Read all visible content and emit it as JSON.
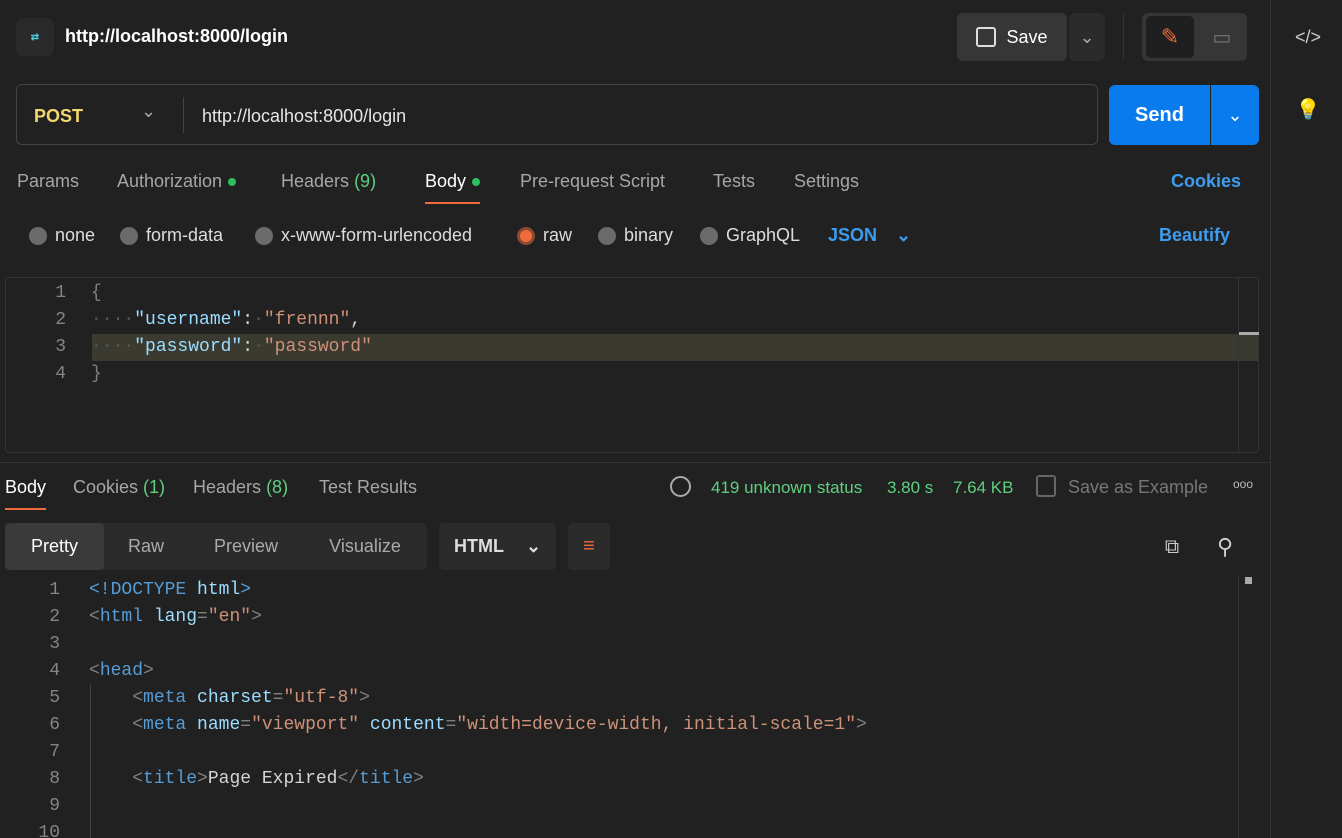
{
  "header": {
    "title": "http://localhost:8000/login",
    "save_label": "Save"
  },
  "request": {
    "method": "POST",
    "url": "http://localhost:8000/login",
    "send_label": "Send"
  },
  "req_tabs": [
    {
      "label": "Params"
    },
    {
      "label": "Authorization",
      "dot": true
    },
    {
      "label": "Headers",
      "count": "(9)"
    },
    {
      "label": "Body",
      "dot": true,
      "active": true
    },
    {
      "label": "Pre-request Script"
    },
    {
      "label": "Tests"
    },
    {
      "label": "Settings"
    }
  ],
  "cookies_link": "Cookies",
  "body_types": [
    {
      "label": "none"
    },
    {
      "label": "form-data"
    },
    {
      "label": "x-www-form-urlencoded"
    },
    {
      "label": "raw",
      "selected": true
    },
    {
      "label": "binary"
    },
    {
      "label": "GraphQL"
    }
  ],
  "body_format": "JSON",
  "beautify_label": "Beautify",
  "request_body": [
    [
      [
        "t-pun",
        "{"
      ]
    ],
    [
      [
        "t-ws",
        "····"
      ],
      [
        "t-key",
        "\"username\""
      ],
      [
        "t-txt",
        ":"
      ],
      [
        "t-ws",
        "·"
      ],
      [
        "t-str",
        "\"frennn\""
      ],
      [
        "t-txt",
        ","
      ]
    ],
    [
      [
        "t-ws",
        "····"
      ],
      [
        "t-key",
        "\"password\""
      ],
      [
        "t-txt",
        ":"
      ],
      [
        "t-ws",
        "·"
      ],
      [
        "t-str",
        "\"password\""
      ]
    ],
    [
      [
        "t-pun",
        "}"
      ]
    ]
  ],
  "resp_tabs": [
    {
      "label": "Body",
      "active": true
    },
    {
      "label": "Cookies",
      "count": "(1)"
    },
    {
      "label": "Headers",
      "count": "(8)"
    },
    {
      "label": "Test Results"
    }
  ],
  "response": {
    "status": "419 unknown status",
    "time": "3.80 s",
    "size": "7.64 KB",
    "save_example": "Save as Example"
  },
  "view_modes": [
    {
      "label": "Pretty",
      "active": true
    },
    {
      "label": "Raw"
    },
    {
      "label": "Preview"
    },
    {
      "label": "Visualize"
    }
  ],
  "resp_format": "HTML",
  "response_body": [
    [
      [
        "t-tag",
        "<!DOCTYPE "
      ],
      [
        "t-attr",
        "html"
      ],
      [
        "t-tag",
        ">"
      ]
    ],
    [
      [
        "t-pun",
        "<"
      ],
      [
        "t-tag",
        "html "
      ],
      [
        "t-attr",
        "lang"
      ],
      [
        "t-pun",
        "="
      ],
      [
        "t-str",
        "\"en\""
      ],
      [
        "t-pun",
        ">"
      ]
    ],
    [],
    [
      [
        "t-pun",
        "<"
      ],
      [
        "t-tag",
        "head"
      ],
      [
        "t-pun",
        ">"
      ]
    ],
    [
      [
        "t-txt",
        "    "
      ],
      [
        "t-pun",
        "<"
      ],
      [
        "t-tag",
        "meta "
      ],
      [
        "t-attr",
        "charset"
      ],
      [
        "t-pun",
        "="
      ],
      [
        "t-str",
        "\"utf-8\""
      ],
      [
        "t-pun",
        ">"
      ]
    ],
    [
      [
        "t-txt",
        "    "
      ],
      [
        "t-pun",
        "<"
      ],
      [
        "t-tag",
        "meta "
      ],
      [
        "t-attr",
        "name"
      ],
      [
        "t-pun",
        "="
      ],
      [
        "t-str",
        "\"viewport\" "
      ],
      [
        "t-attr",
        "content"
      ],
      [
        "t-pun",
        "="
      ],
      [
        "t-str",
        "\"width=device-width, initial-scale=1\""
      ],
      [
        "t-pun",
        ">"
      ]
    ],
    [],
    [
      [
        "t-txt",
        "    "
      ],
      [
        "t-pun",
        "<"
      ],
      [
        "t-tag",
        "title"
      ],
      [
        "t-pun",
        ">"
      ],
      [
        "t-txt",
        "Page Expired"
      ],
      [
        "t-pun",
        "</"
      ],
      [
        "t-tag",
        "title"
      ],
      [
        "t-pun",
        ">"
      ]
    ],
    [],
    []
  ],
  "colors": {
    "accent": "#f26b3a",
    "send": "#097bed",
    "method": "#f5d76e",
    "status": "#5fcf80"
  }
}
